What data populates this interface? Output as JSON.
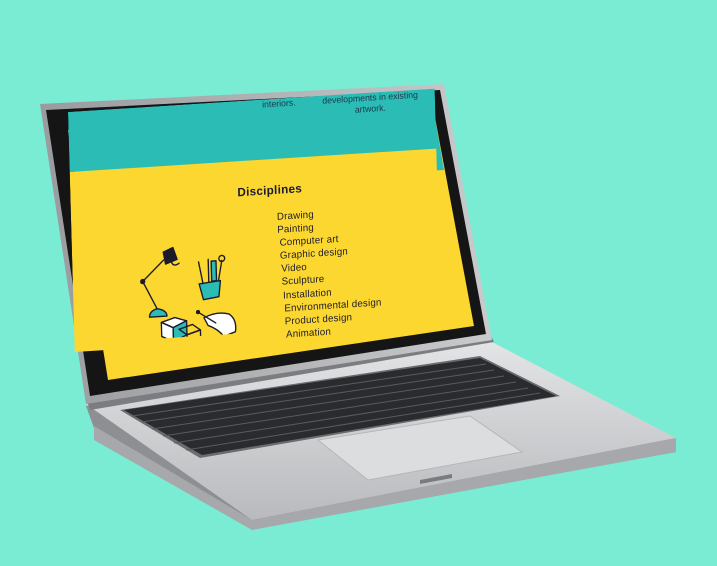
{
  "screen": {
    "header_partial": {
      "left_text": "interiors.",
      "right_line1": "developments in existing",
      "right_line2": "artwork."
    },
    "section_title": "Disciplines",
    "disciplines": [
      "Drawing",
      "Painting",
      "Computer art",
      "Graphic design",
      "Video",
      "Sculpture",
      "Installation",
      "Environmental design",
      "Product design",
      "Animation"
    ],
    "illustration_icon": "art-tools-illustration"
  },
  "colors": {
    "background": "#79ecd3",
    "screen_teal": "#2bbcb6",
    "screen_yellow": "#fcd730",
    "text_dark": "#1b1b2a",
    "laptop_silver": "#d2d3d5",
    "bezel": "#151515",
    "keys": "#2a2b2e"
  }
}
